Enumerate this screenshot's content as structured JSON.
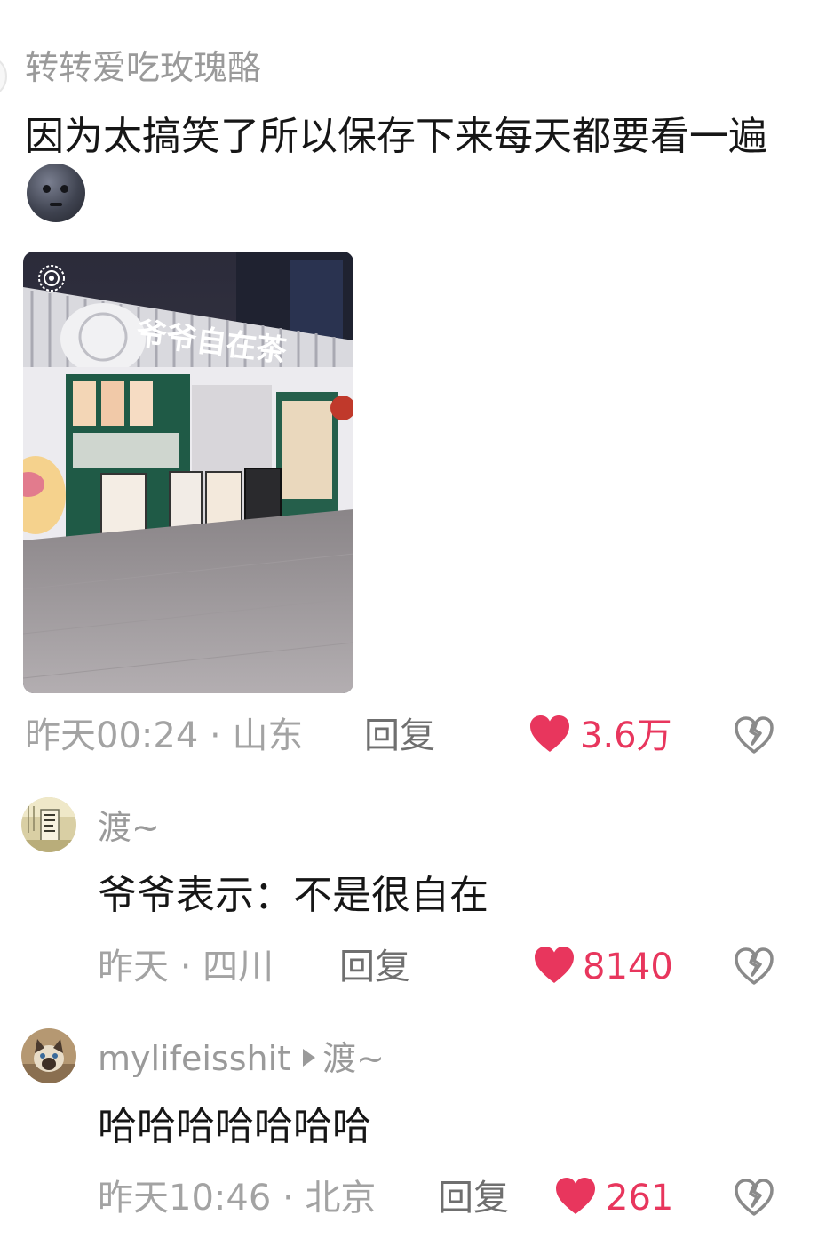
{
  "comments": [
    {
      "username": "转转爱吃玫瑰酪",
      "text": "因为太搞笑了所以保存下来每天都要看一遍",
      "emoji": "new-moon-face-icon",
      "photo_sign_text": "爷爷自在茶",
      "time": "昨天00:24",
      "location": "山东",
      "reply_label": "回复",
      "likes": "3.6万"
    },
    {
      "username": "渡~",
      "text": "爷爷表示：不是很自在",
      "time": "昨天",
      "location": "四川",
      "reply_label": "回复",
      "likes": "8140"
    },
    {
      "username": "mylifeisshit",
      "reply_to": "渡~",
      "text": "哈哈哈哈哈哈哈",
      "time": "昨天10:46",
      "location": "北京",
      "reply_label": "回复",
      "likes": "261"
    }
  ],
  "separator": " · ",
  "colors": {
    "like": "#e8365d",
    "meta": "#a3a3a3",
    "username": "#9a9a9a",
    "text": "#161616"
  }
}
